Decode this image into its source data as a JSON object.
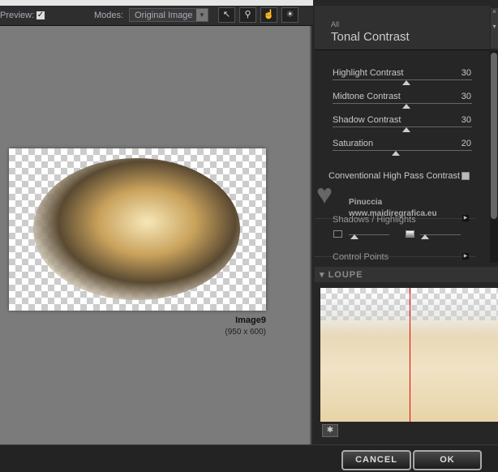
{
  "toolbar": {
    "preview_label": "Preview:",
    "preview_checked": true,
    "modes_label": "Modes:",
    "modes_value": "Original Image",
    "tools": [
      {
        "icon": "arrow-select-icon",
        "glyph": "↖"
      },
      {
        "icon": "zoom-icon",
        "glyph": "🔍"
      },
      {
        "icon": "hand-icon",
        "glyph": "✋"
      },
      {
        "icon": "lightbulb-icon",
        "glyph": "☀"
      }
    ]
  },
  "image": {
    "name": "Image9",
    "size": "(950 x 600)"
  },
  "panel": {
    "category": "All",
    "title": "Tonal Contrast",
    "sliders": [
      {
        "label": "Highlight Contrast",
        "value": "30",
        "fraction": 0.5
      },
      {
        "label": "Midtone Contrast",
        "value": "30",
        "fraction": 0.5
      },
      {
        "label": "Shadow Contrast",
        "value": "30",
        "fraction": 0.5
      },
      {
        "label": "Saturation",
        "value": "20",
        "fraction": 0.43
      }
    ],
    "high_pass_label": "Conventional High Pass Contrast",
    "high_pass_checked": false,
    "shadows_highlights": "Shadows / Highlights",
    "control_points": "Control Points"
  },
  "watermark": {
    "name": "Pinuccia",
    "url": "www.maidiregrafica.eu"
  },
  "loupe": {
    "label": "LOUPE"
  },
  "buttons": {
    "cancel": "CANCEL",
    "ok": "OK"
  },
  "colors": {
    "loupe_line": "#e00000"
  }
}
